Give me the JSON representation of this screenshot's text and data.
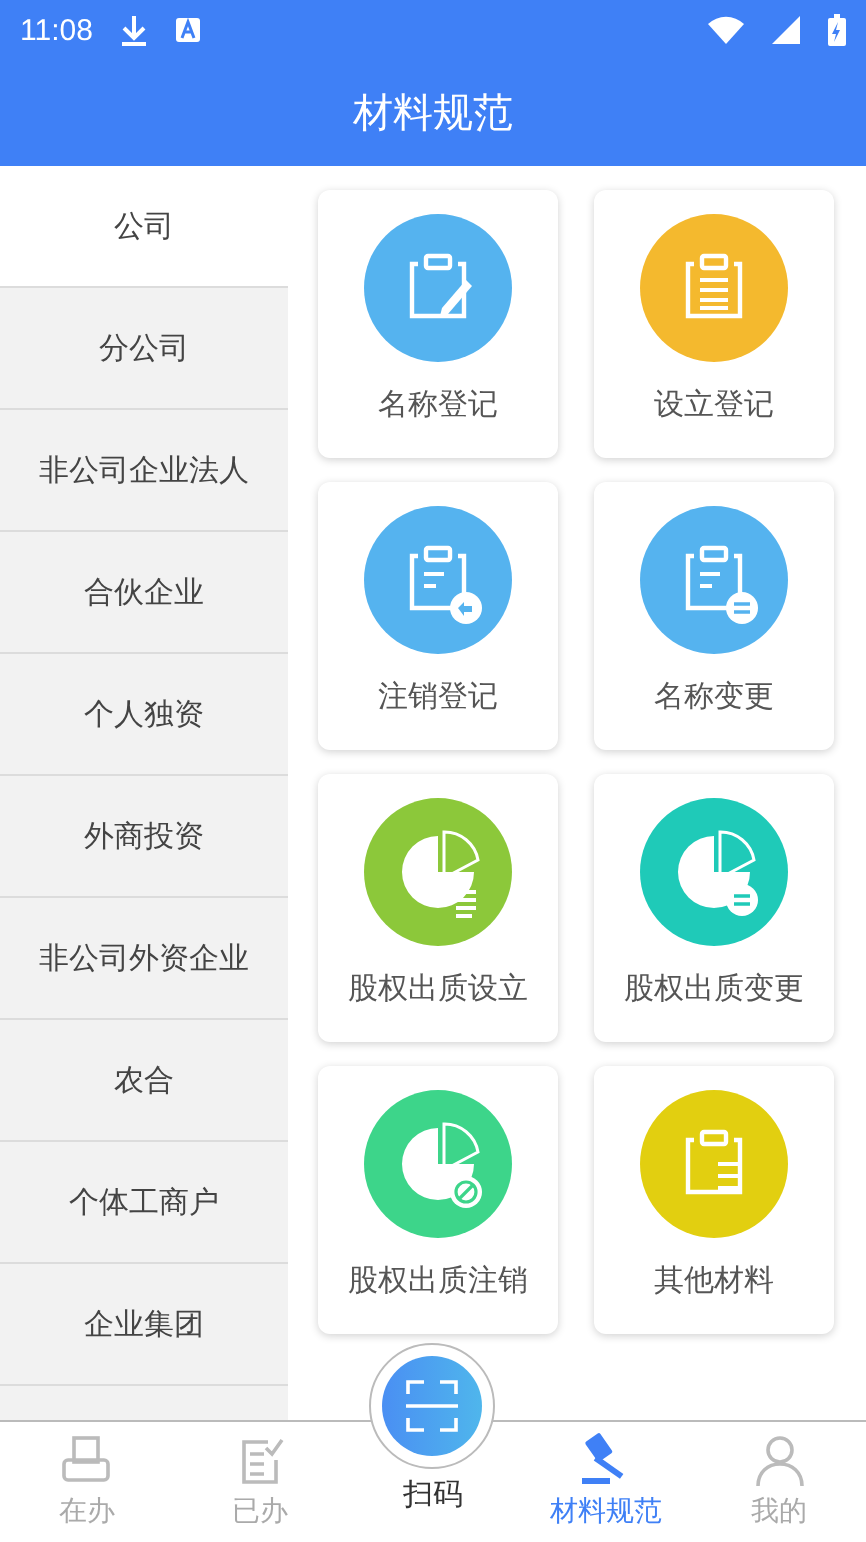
{
  "status_bar": {
    "time": "11:08"
  },
  "header": {
    "title": "材料规范"
  },
  "sidebar": {
    "items": [
      {
        "label": "公司",
        "selected": true
      },
      {
        "label": "分公司",
        "selected": false
      },
      {
        "label": "非公司企业法人",
        "selected": false
      },
      {
        "label": "合伙企业",
        "selected": false
      },
      {
        "label": "个人独资",
        "selected": false
      },
      {
        "label": "外商投资",
        "selected": false
      },
      {
        "label": "非公司外资企业",
        "selected": false
      },
      {
        "label": "农合",
        "selected": false
      },
      {
        "label": "个体工商户",
        "selected": false
      },
      {
        "label": "企业集团",
        "selected": false
      }
    ]
  },
  "cards": [
    {
      "label": "名称登记",
      "kind": "edit",
      "color": "#55b3ef"
    },
    {
      "label": "设立登记",
      "kind": "list",
      "color": "#f4b92e"
    },
    {
      "label": "注销登记",
      "kind": "back",
      "color": "#55b3ef"
    },
    {
      "label": "名称变更",
      "kind": "swap",
      "color": "#55b3ef"
    },
    {
      "label": "股权出质设立",
      "kind": "pie-doc",
      "color": "#8cc83a"
    },
    {
      "label": "股权出质变更",
      "kind": "pie-swap",
      "color": "#1fcab8"
    },
    {
      "label": "股权出质注销",
      "kind": "pie-ban",
      "color": "#3dd58a"
    },
    {
      "label": "其他材料",
      "kind": "sliders",
      "color": "#e2cf10"
    }
  ],
  "tabs": [
    {
      "label": "在办",
      "kind": "printer",
      "selected": false
    },
    {
      "label": "已办",
      "kind": "done",
      "selected": false
    },
    {
      "label": "扫码",
      "kind": "scan",
      "selected": false
    },
    {
      "label": "材料规范",
      "kind": "gavel",
      "selected": true
    },
    {
      "label": "我的",
      "kind": "person",
      "selected": false
    }
  ]
}
